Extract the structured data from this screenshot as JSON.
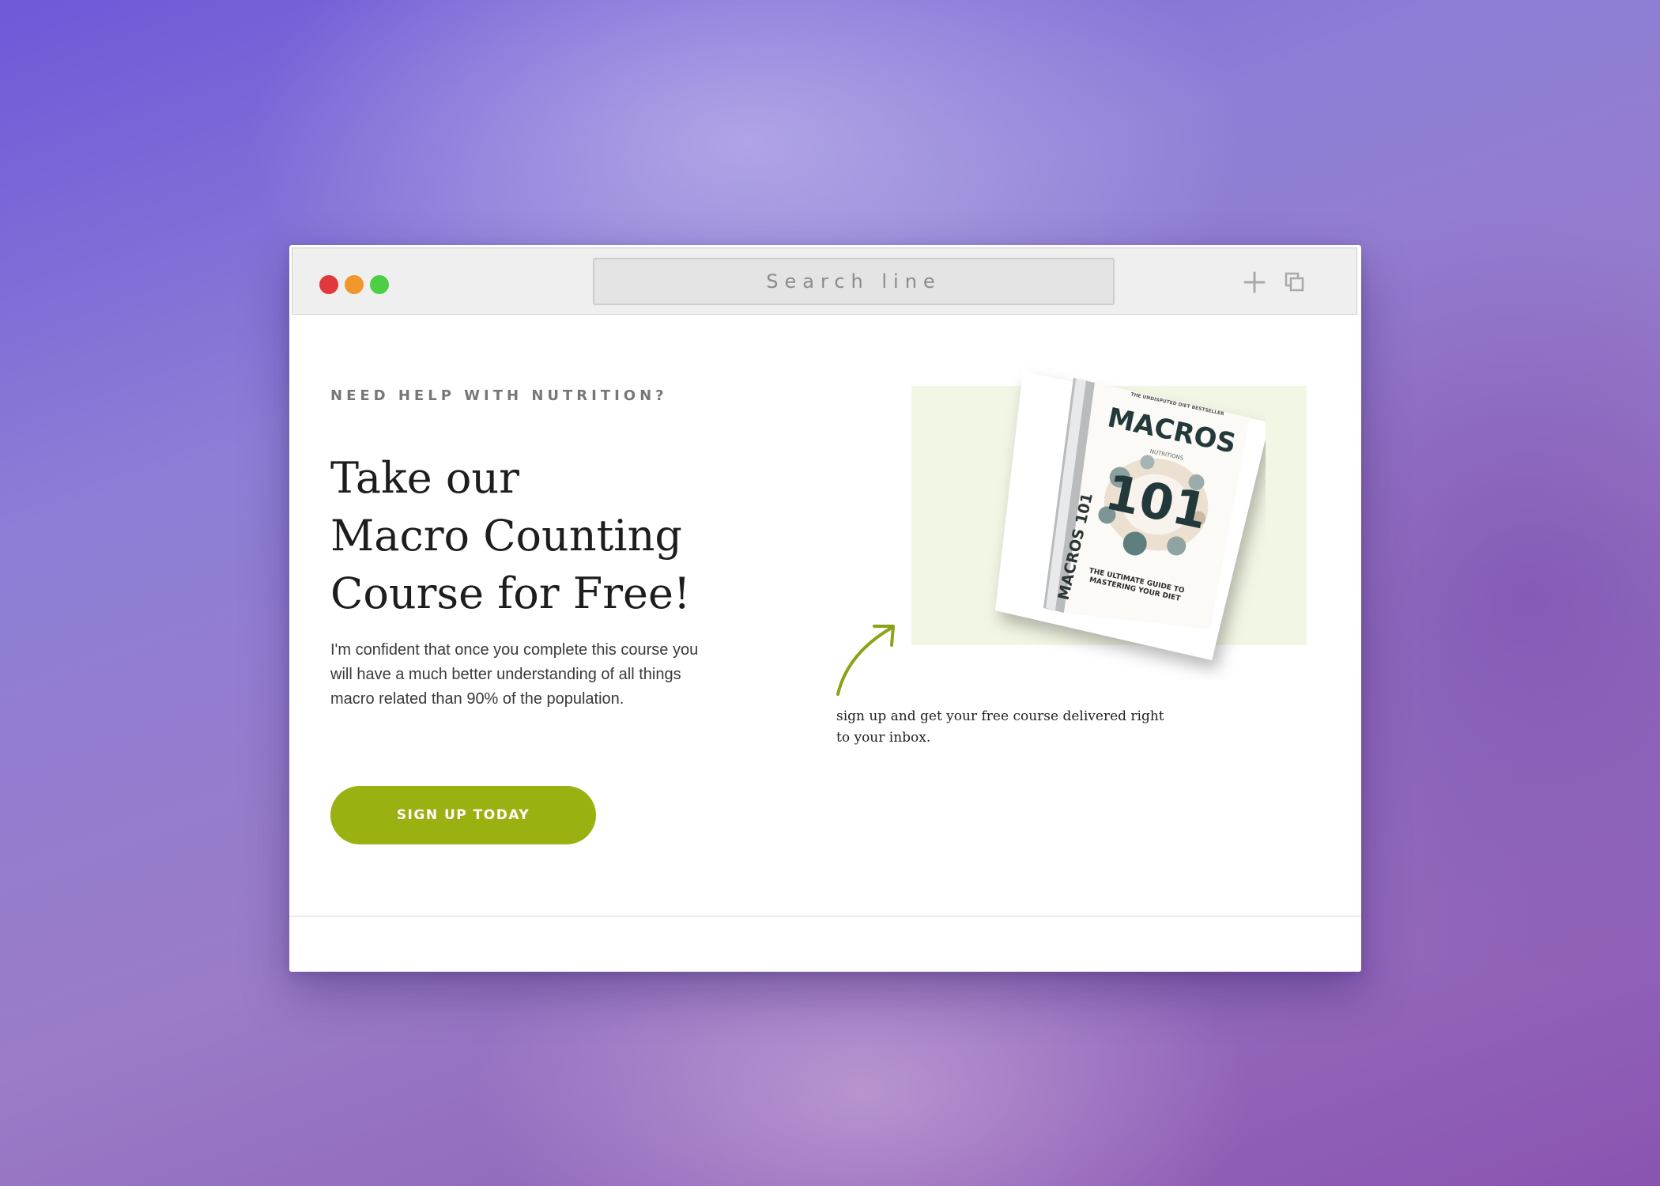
{
  "window": {
    "search_placeholder": "Search line",
    "controls": {
      "close_color": "#e0383c",
      "minimize_color": "#f0962a",
      "maximize_color": "#4dcf45"
    },
    "icons": [
      "plus-icon",
      "copy-icon"
    ]
  },
  "hero": {
    "eyebrow": "NEED HELP WITH NUTRITION?",
    "headline_lines": [
      "Take our",
      "Macro Counting",
      "Course for Free!"
    ],
    "body": "I'm confident that once you complete this course you will have a much better understanding of all things macro related than 90% of the population.",
    "cta_label": "SIGN UP TODAY",
    "accent_color": "#9bb111"
  },
  "book": {
    "tagline": "THE UNDISPUTED DIET BESTSELLER",
    "title": "MACROS",
    "subtitle": "NUTRITIONS",
    "number": "101",
    "spine": "MACROS 101",
    "description_line1": "THE ULTIMATE GUIDE TO",
    "description_line2": "MASTERING YOUR DIET"
  },
  "signup_note": "sign up and get your free course delivered right to your inbox."
}
